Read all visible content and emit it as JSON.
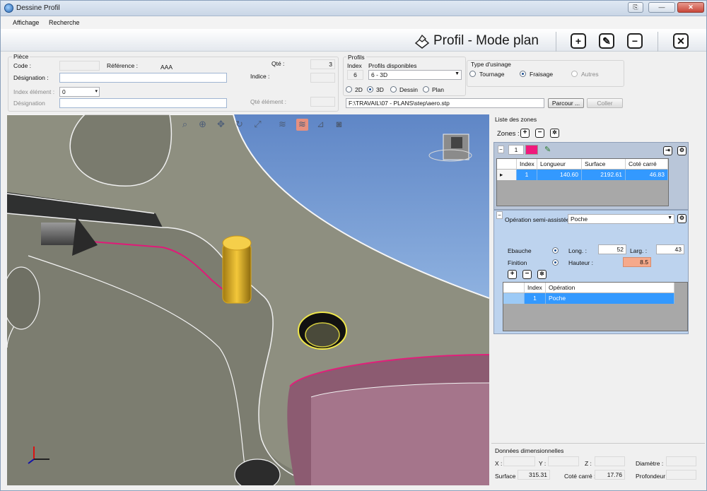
{
  "window": {
    "title": "Dessine Profil",
    "controls": [
      "⎘",
      "—",
      "✕"
    ]
  },
  "menu": {
    "items": [
      "Affichage",
      "Recherche"
    ]
  },
  "header": {
    "title": "Profil - Mode plan",
    "buttons": [
      "+",
      "✎",
      "−",
      "✕"
    ]
  },
  "piece": {
    "section_label": "Pièce",
    "code_label": "Code :",
    "code_value": "",
    "reference_label": "Référence :",
    "reference_value": "AAA",
    "qte_label": "Qté :",
    "qte_value": "3",
    "designation_label": "Désignation :",
    "designation_value": "",
    "indice_label": "Indice :",
    "indice_value": "",
    "index_element_label": "Index élément :",
    "index_element_value": "0",
    "designation2_label": "Désignation",
    "designation2_value": "",
    "qte_element_label": "Qté élément :",
    "qte_element_value": ""
  },
  "profils": {
    "section_label": "Profils",
    "index_label": "Index",
    "index_value": "6",
    "disponibles_label": "Profils disponibles",
    "disponibles_value": "6 - 3D",
    "view_options": [
      "2D",
      "3D",
      "Dessin",
      "Plan"
    ],
    "view_selected": "3D",
    "path": "F:\\TRAVAIL\\07 - PLANS\\step\\aero.stp",
    "parcourir_label": "Parcour ...",
    "coller_label": "Coller"
  },
  "usinage": {
    "label": "Type d'usinage",
    "options": [
      "Tournage",
      "Fraisage",
      "Autres"
    ],
    "selected": "Fraisage"
  },
  "viewport_toolbar": [
    "search-zoom-icon",
    "zoom-icon",
    "pan-icon",
    "rotate-icon",
    "fit-icon",
    "profile-a-icon",
    "profile-b-icon",
    "section-icon",
    "camera-icon"
  ],
  "zones": {
    "list_label": "Liste des zones",
    "zones_label": "Zones :",
    "zone_number": "1",
    "zone_color": "#f0197c",
    "table": {
      "headers": [
        "Index",
        "Longueur",
        "Surface",
        "Coté carré"
      ],
      "rows": [
        [
          "1",
          "140.60",
          "2192.61",
          "46.83"
        ]
      ]
    }
  },
  "operation": {
    "label": "Opération semi-assistée :",
    "value": "Poche",
    "ebauche_label": "Ebauche",
    "finition_label": "Finition",
    "long_label": "Long. :",
    "long_value": "52",
    "larg_label": "Larg. :",
    "larg_value": "43",
    "hauteur_label": "Hauteur :",
    "hauteur_value": "8.5",
    "table": {
      "headers": [
        "Index",
        "Opération"
      ],
      "rows": [
        [
          "1",
          "Poche"
        ]
      ]
    }
  },
  "dimensions": {
    "label": "Données dimensionnelles",
    "x_label": "X :",
    "x_value": "",
    "y_label": "Y :",
    "y_value": "",
    "z_label": "Z :",
    "z_value": "",
    "diametre_label": "Diamètre :",
    "diametre_value": "",
    "surface_label": "Surface :",
    "surface_value": "315.31",
    "cote_label": "Coté carré :",
    "cote_value": "17.76",
    "profondeur_label": "Profondeur :",
    "profondeur_value": ""
  },
  "colors": {
    "selection": "#3399ff",
    "zone_pink": "#f0197c",
    "highlight_yellow": "#f0c419",
    "hauteur_bg": "#f6a98b"
  }
}
